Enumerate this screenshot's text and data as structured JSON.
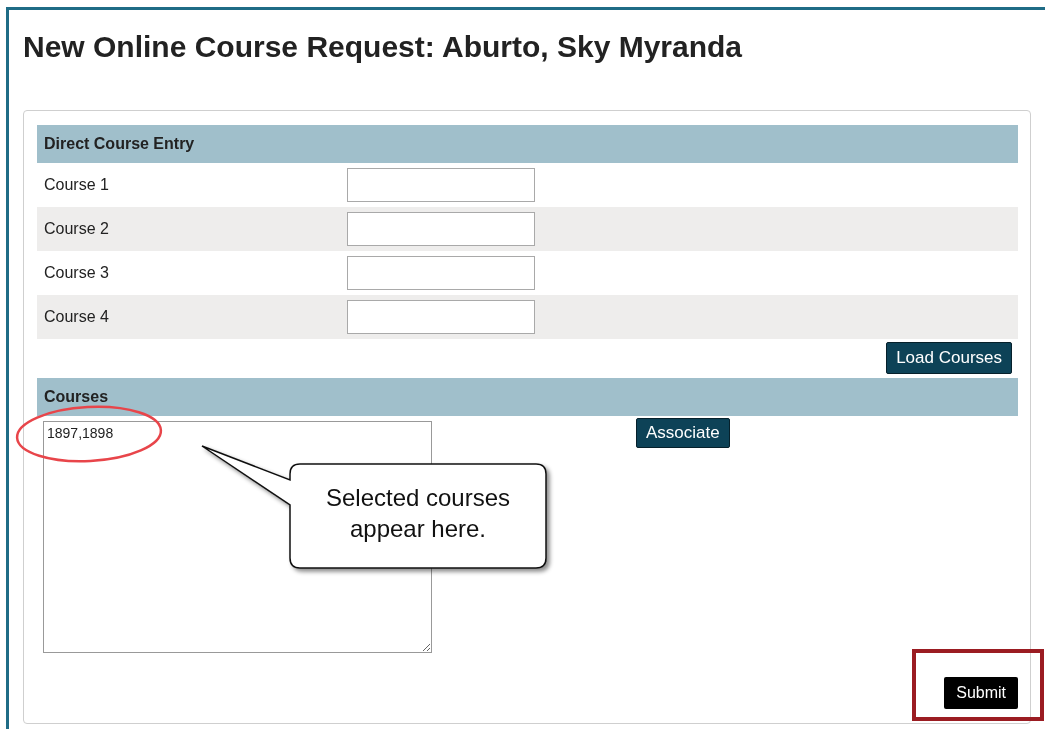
{
  "title": "New Online Course Request: Aburto, Sky Myranda",
  "direct_entry": {
    "heading": "Direct Course Entry",
    "rows": [
      {
        "label": "Course 1"
      },
      {
        "label": "Course 2"
      },
      {
        "label": "Course 3"
      },
      {
        "label": "Course 4"
      }
    ],
    "button": "Load Courses"
  },
  "courses": {
    "heading": "Courses",
    "value": "1897,1898",
    "button": "Associate"
  },
  "callout": "Selected courses appear here.",
  "submit": "Submit"
}
